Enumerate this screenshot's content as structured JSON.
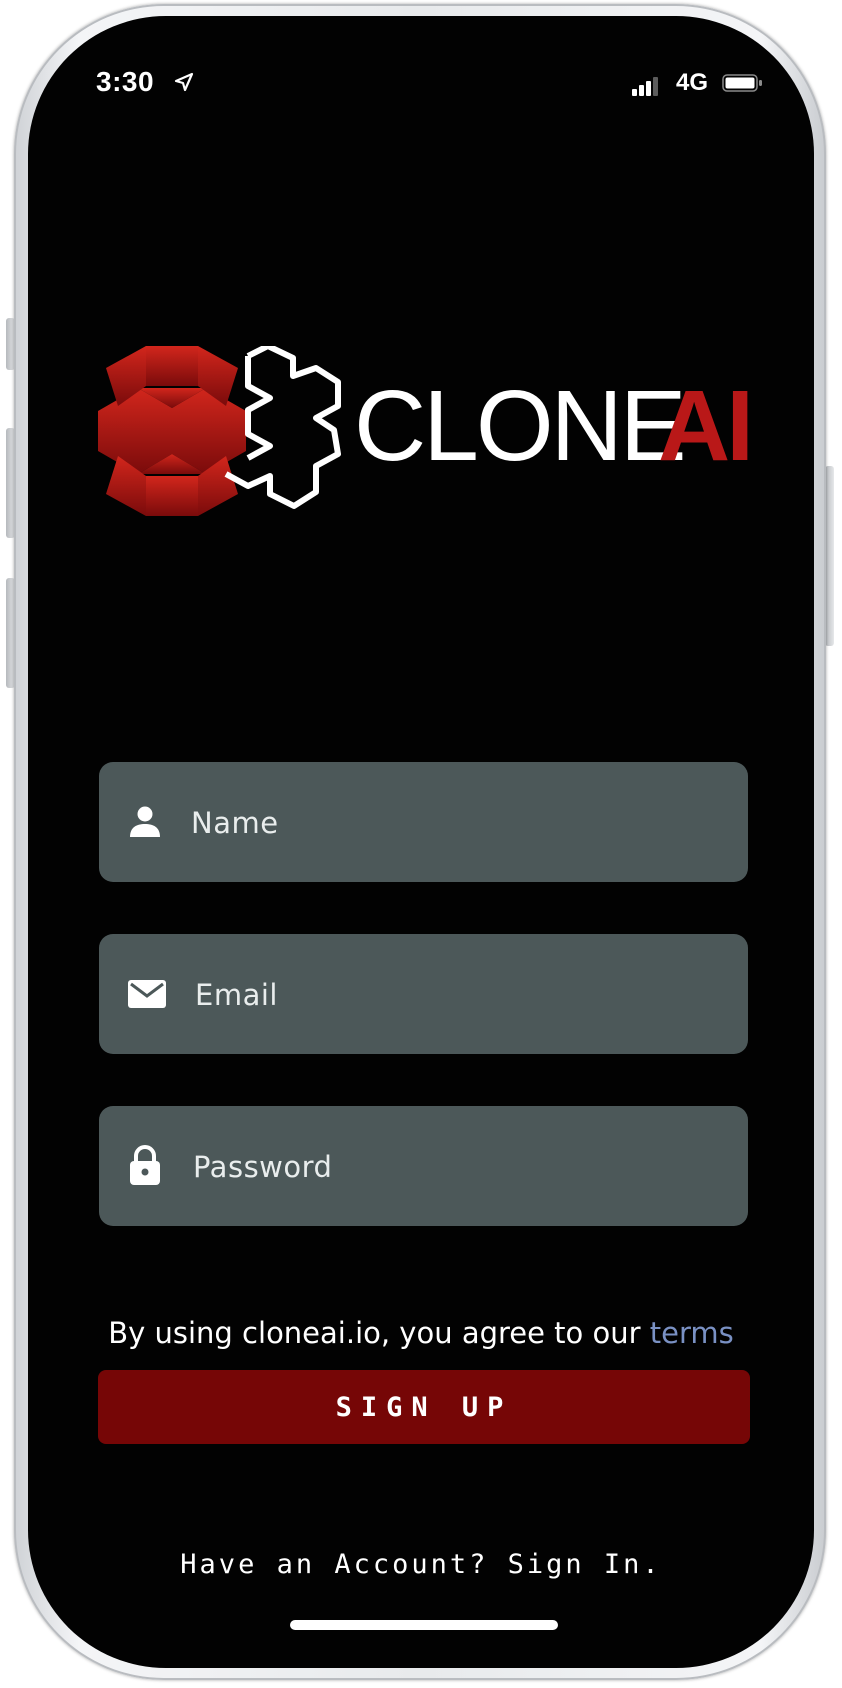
{
  "status_bar": {
    "time": "3:30",
    "network": "4G",
    "icons": [
      "location-arrow-icon",
      "cellular-signal-icon",
      "battery-icon"
    ]
  },
  "logo": {
    "text_primary": "CLONE",
    "text_accent": "AI",
    "accent_color": "#b91818"
  },
  "form": {
    "name": {
      "placeholder": "Name",
      "value": "",
      "icon": "person-icon"
    },
    "email": {
      "placeholder": "Email",
      "value": "",
      "icon": "envelope-icon"
    },
    "password": {
      "placeholder": "Password",
      "value": "",
      "icon": "lock-icon"
    }
  },
  "terms": {
    "prefix": "By using cloneai.io, you agree to our ",
    "link_label": "terms",
    "link_color": "#7a91c4"
  },
  "signup_button": {
    "label": "SIGN UP",
    "color": "#760606"
  },
  "signin_link": {
    "label": "Have an Account? Sign In."
  },
  "colors": {
    "background": "#020202",
    "field_bg": "#4c5859"
  }
}
